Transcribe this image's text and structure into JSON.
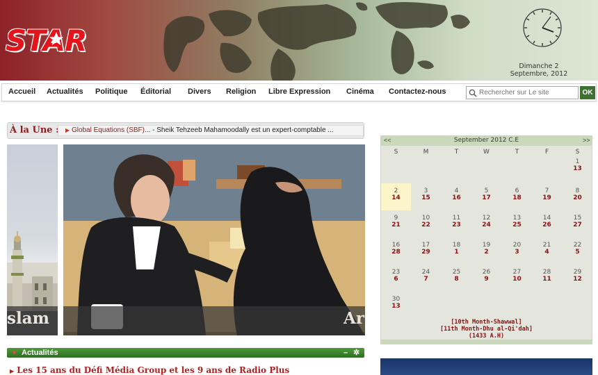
{
  "header": {
    "logo_text": "STAR",
    "date_line1": "Dimanche 2",
    "date_line2": "Septembre, 2012"
  },
  "nav": {
    "items": [
      "Accueil",
      "Actualités",
      "Politique",
      "Éditorial",
      "Divers",
      "Religion",
      "Libre Expression",
      "Cinéma",
      "Contactez-nous"
    ],
    "search_placeholder": "Rechercher sur Le site",
    "ok_label": "OK"
  },
  "une": {
    "label": "À la Une :",
    "link_text": "Global Equations (SBF)",
    "rest_text": "... - Sheik Tehzeeb Mahamoodally est un expert-comptable ..."
  },
  "slideshow": {
    "left_caption": "slam",
    "main_caption": "Ar"
  },
  "actualites": {
    "title": "Actualités",
    "minimize": "–",
    "settings": "✲",
    "first_item": "Les 15 ans du Défi Média Group et les 9 ans de Radio Plus"
  },
  "calendar": {
    "title": "September 2012 C.E",
    "prev": "<<",
    "next": ">>",
    "weekdays": [
      "S",
      "M",
      "T",
      "W",
      "T",
      "F",
      "S"
    ],
    "weeks": [
      [
        null,
        null,
        null,
        null,
        null,
        null,
        {
          "g": "1",
          "h": "13"
        }
      ],
      [
        {
          "g": "2",
          "h": "14",
          "today": true
        },
        {
          "g": "3",
          "h": "15"
        },
        {
          "g": "4",
          "h": "16"
        },
        {
          "g": "5",
          "h": "17"
        },
        {
          "g": "6",
          "h": "18"
        },
        {
          "g": "7",
          "h": "19"
        },
        {
          "g": "8",
          "h": "20"
        }
      ],
      [
        {
          "g": "9",
          "h": "21"
        },
        {
          "g": "10",
          "h": "22"
        },
        {
          "g": "11",
          "h": "23"
        },
        {
          "g": "12",
          "h": "24"
        },
        {
          "g": "13",
          "h": "25"
        },
        {
          "g": "14",
          "h": "26"
        },
        {
          "g": "15",
          "h": "27"
        }
      ],
      [
        {
          "g": "16",
          "h": "28"
        },
        {
          "g": "17",
          "h": "29"
        },
        {
          "g": "18",
          "h": "1"
        },
        {
          "g": "19",
          "h": "2"
        },
        {
          "g": "20",
          "h": "3"
        },
        {
          "g": "21",
          "h": "4"
        },
        {
          "g": "22",
          "h": "5"
        }
      ],
      [
        {
          "g": "23",
          "h": "6"
        },
        {
          "g": "24",
          "h": "7"
        },
        {
          "g": "25",
          "h": "8"
        },
        {
          "g": "26",
          "h": "9"
        },
        {
          "g": "27",
          "h": "10"
        },
        {
          "g": "28",
          "h": "11"
        },
        {
          "g": "29",
          "h": "12"
        }
      ],
      [
        {
          "g": "30",
          "h": "13"
        },
        null,
        null,
        null,
        null,
        null,
        null
      ]
    ],
    "footer_line1": "[10th Month-Shawwal]",
    "footer_line2": "[11th Month-Dhu al-Qi'dah]",
    "footer_line3": "(1433 A.H)"
  },
  "colors": {
    "brand_red": "#e3141c",
    "calendar_hijri": "#8b0f0f",
    "actu_green": "#2d6e22"
  }
}
